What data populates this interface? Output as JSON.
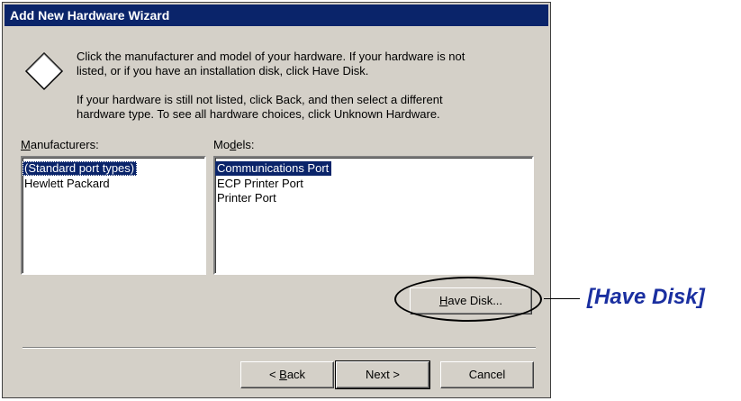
{
  "window": {
    "title": "Add New Hardware Wizard"
  },
  "instructions": {
    "line1": "Click the manufacturer and model of your hardware. If your hardware is not",
    "line2": "listed, or if you have an installation disk, click Have Disk.",
    "line3": "If your hardware is still not listed, click Back, and then select a different",
    "line4": "hardware type. To see all hardware choices, click Unknown Hardware."
  },
  "manufacturers": {
    "label_accel": "M",
    "label_rest": "anufacturers:",
    "items": [
      "(Standard port types)",
      "Hewlett Packard"
    ],
    "selected_index": 0
  },
  "models": {
    "label_pre": "Mo",
    "label_accel": "d",
    "label_rest": "els:",
    "items": [
      "Communications Port",
      "ECP Printer Port",
      "Printer Port"
    ],
    "selected_index": 0
  },
  "buttons": {
    "have_disk": {
      "accel": "H",
      "rest": "ave Disk..."
    },
    "back": {
      "pre": "< ",
      "accel": "B",
      "rest": "ack"
    },
    "next": "Next >",
    "cancel": "Cancel"
  },
  "annotation": {
    "label": "[Have Disk]"
  },
  "colors": {
    "titlebar": "#0a246a",
    "dialog_bg": "#d4d0c8",
    "selection": "#0a246a",
    "annotation_text": "#1a2fa0"
  },
  "icons": {
    "hardware_icon": "diamond-icon"
  }
}
